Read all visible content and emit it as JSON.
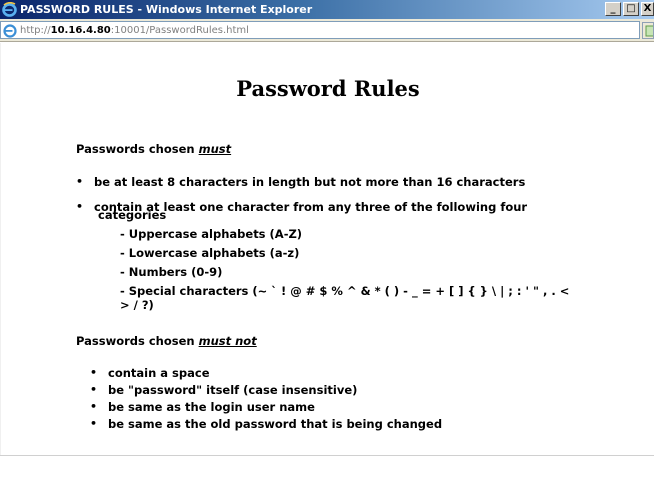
{
  "window": {
    "title": "PASSWORD RULES - Windows Internet Explorer",
    "minimize_label": "_",
    "maximize_label": "□",
    "close_label": "X"
  },
  "address": {
    "protocol": "http://",
    "host": "10.16.4.80",
    "rest": ":10001/PasswordRules.html"
  },
  "page": {
    "title": "Password Rules",
    "must_section": {
      "lead_prefix": "Passwords chosen ",
      "lead_emphasis": "must",
      "items": [
        "be at least 8 characters in length but not more than 16 characters",
        "contain at least one character from any three of the following four",
        "categories"
      ],
      "categories": [
        "- Uppercase alphabets (A-Z)",
        "- Lowercase alphabets (a-z)",
        "- Numbers (0-9)",
        "- Special characters (~ ` ! @ # $ % ^ & * ( ) - _ = + [ ] { } \\ | ; : ' \" , . <",
        "> / ?)"
      ]
    },
    "must_not_section": {
      "lead_prefix": "Passwords chosen ",
      "lead_emphasis": "must not",
      "items": [
        "contain a space",
        "be \"password\" itself (case insensitive)",
        "be same as the login user name",
        "be same as the old password that is being changed"
      ]
    },
    "bullet": "•"
  }
}
